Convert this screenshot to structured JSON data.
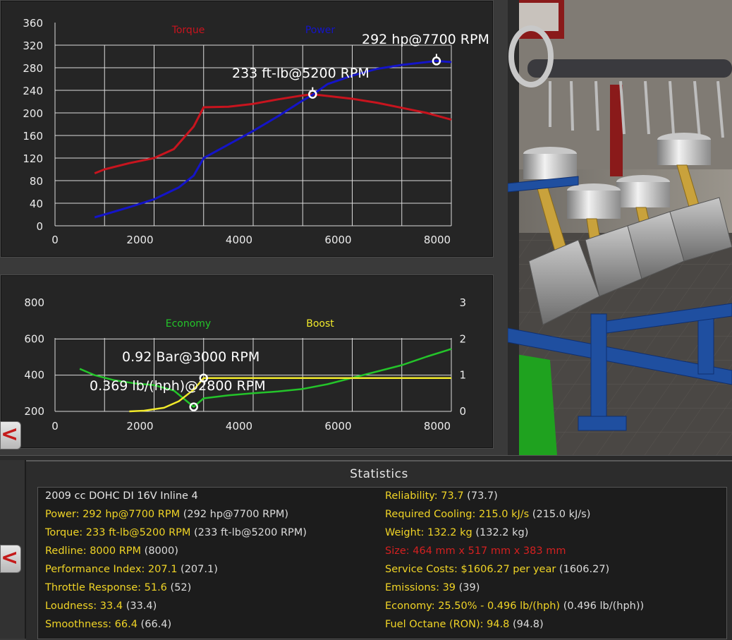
{
  "torque_chart": {
    "legend_torque": "Torque",
    "legend_power": "Power",
    "torque_color": "#c8141e",
    "power_color": "#1414c8",
    "y_ticks": [
      "360",
      "320",
      "280",
      "240",
      "200",
      "160",
      "120",
      "80",
      "40",
      "0"
    ],
    "x_ticks": [
      "0",
      "2000",
      "4000",
      "6000",
      "8000"
    ],
    "torque_annotation": "233 ft-lb@5200 RPM",
    "power_annotation": "292 hp@7700 RPM"
  },
  "econ_chart": {
    "legend_economy": "Economy",
    "legend_boost": "Boost",
    "economy_color": "#24c42a",
    "boost_color": "#f2ea2a",
    "y_left_ticks": [
      "800",
      "600",
      "400",
      "200"
    ],
    "y_right_ticks": [
      "3",
      "2",
      "1",
      "0"
    ],
    "x_ticks": [
      "0",
      "2000",
      "4000",
      "6000",
      "8000"
    ],
    "boost_annotation": "0.92 Bar@3000 RPM",
    "economy_annotation": "0.369 lb/(hph)@2800 RPM"
  },
  "chart_data": [
    {
      "type": "line",
      "xlim": [
        0,
        8000
      ],
      "ylim": [
        0,
        360
      ],
      "grid": true,
      "legend_placement": "top",
      "series": [
        {
          "name": "Torque",
          "x": [
            800,
            1000,
            1500,
            2000,
            2400,
            2800,
            3000,
            3500,
            4000,
            4500,
            5000,
            5200,
            5500,
            6000,
            6500,
            7000,
            7500,
            8000
          ],
          "y": [
            93,
            100,
            111,
            120,
            136,
            176,
            210,
            211,
            216,
            224,
            231,
            233,
            230,
            225,
            218,
            209,
            200,
            188
          ]
        },
        {
          "name": "Power",
          "x": [
            800,
            1000,
            1500,
            2000,
            2500,
            2800,
            3000,
            3500,
            4000,
            4500,
            5000,
            5200,
            5500,
            6000,
            6500,
            7000,
            7500,
            7700,
            8000
          ],
          "y": [
            15,
            20,
            33,
            47,
            68,
            89,
            120,
            144,
            168,
            194,
            222,
            232,
            251,
            266,
            278,
            285,
            290,
            292,
            290
          ]
        }
      ],
      "annotations": [
        {
          "x": 5200,
          "y": 233,
          "label": "233 ft-lb@5200 RPM"
        },
        {
          "x": 7700,
          "y": 292,
          "label": "292 hp@7700 RPM"
        }
      ]
    },
    {
      "type": "line",
      "xlim": [
        0,
        8000
      ],
      "ylim": [
        200,
        800
      ],
      "y2lim": [
        0,
        3
      ],
      "grid": true,
      "legend_placement": "top",
      "series": [
        {
          "name": "Economy",
          "axis": "left",
          "x": [
            500,
            800,
            1200,
            1600,
            2000,
            2400,
            2800,
            3000,
            3500,
            4000,
            4500,
            5000,
            5500,
            6000,
            6500,
            7000,
            7500,
            8000
          ],
          "y": [
            435,
            400,
            372,
            355,
            345,
            315,
            225,
            272,
            289,
            300,
            310,
            324,
            350,
            385,
            420,
            455,
            502,
            545
          ]
        },
        {
          "name": "Boost",
          "axis": "right",
          "x": [
            1500,
            1800,
            2200,
            2500,
            2800,
            3000,
            3500,
            4000,
            5000,
            6000,
            7000,
            8000
          ],
          "y": [
            0,
            0.02,
            0.1,
            0.28,
            0.6,
            0.92,
            0.92,
            0.92,
            0.92,
            0.92,
            0.92,
            0.92
          ]
        }
      ],
      "annotations": [
        {
          "x": 3000,
          "y": 0.92,
          "axis": "right",
          "label": "0.92 Bar@3000 RPM"
        },
        {
          "x": 2800,
          "y": 225,
          "axis": "left",
          "label": "0.369 lb/(hph)@2800 RPM"
        }
      ]
    }
  ],
  "statistics": {
    "title": "Statistics",
    "left": [
      {
        "label": "2009 cc DOHC DI 16V Inline 4",
        "paren": "",
        "style": "white"
      },
      {
        "label": "Power: 292 hp@7700 RPM",
        "paren": " (292 hp@7700 RPM)",
        "style": "yellow"
      },
      {
        "label": "Torque: 233 ft-lb@5200 RPM",
        "paren": " (233 ft-lb@5200 RPM)",
        "style": "yellow"
      },
      {
        "label": "Redline: 8000 RPM",
        "paren": " (8000)",
        "style": "yellow"
      },
      {
        "label": "Performance Index: 207.1",
        "paren": " (207.1)",
        "style": "yellow"
      },
      {
        "label": "Throttle Response: 51.6",
        "paren": " (52)",
        "style": "yellow"
      },
      {
        "label": "Loudness: 33.4",
        "paren": " (33.4)",
        "style": "yellow"
      },
      {
        "label": "Smoothness: 66.4",
        "paren": " (66.4)",
        "style": "yellow"
      }
    ],
    "right": [
      {
        "label": "Reliability: 73.7",
        "paren": " (73.7)",
        "style": "yellow"
      },
      {
        "label": "Required Cooling: 215.0 kJ/s",
        "paren": " (215.0 kJ/s)",
        "style": "yellow"
      },
      {
        "label": "Weight: 132.2 kg",
        "paren": " (132.2 kg)",
        "style": "yellow"
      },
      {
        "label": "Size: 464 mm x 517 mm x 383 mm",
        "paren": "",
        "style": "red"
      },
      {
        "label": "Service Costs: $1606.27 per year",
        "paren": " (1606.27)",
        "style": "yellow"
      },
      {
        "label": "Emissions: 39",
        "paren": " (39)",
        "style": "yellow"
      },
      {
        "label": "Economy: 25.50% - 0.496 lb/(hph)",
        "paren": " (0.496 lb/(hph))",
        "style": "yellow"
      },
      {
        "label": "Fuel Octane (RON): 94.8",
        "paren": " (94.8)",
        "style": "yellow"
      }
    ]
  },
  "nav": {
    "back_top_glyph": "<",
    "back_bottom_glyph": "<"
  }
}
